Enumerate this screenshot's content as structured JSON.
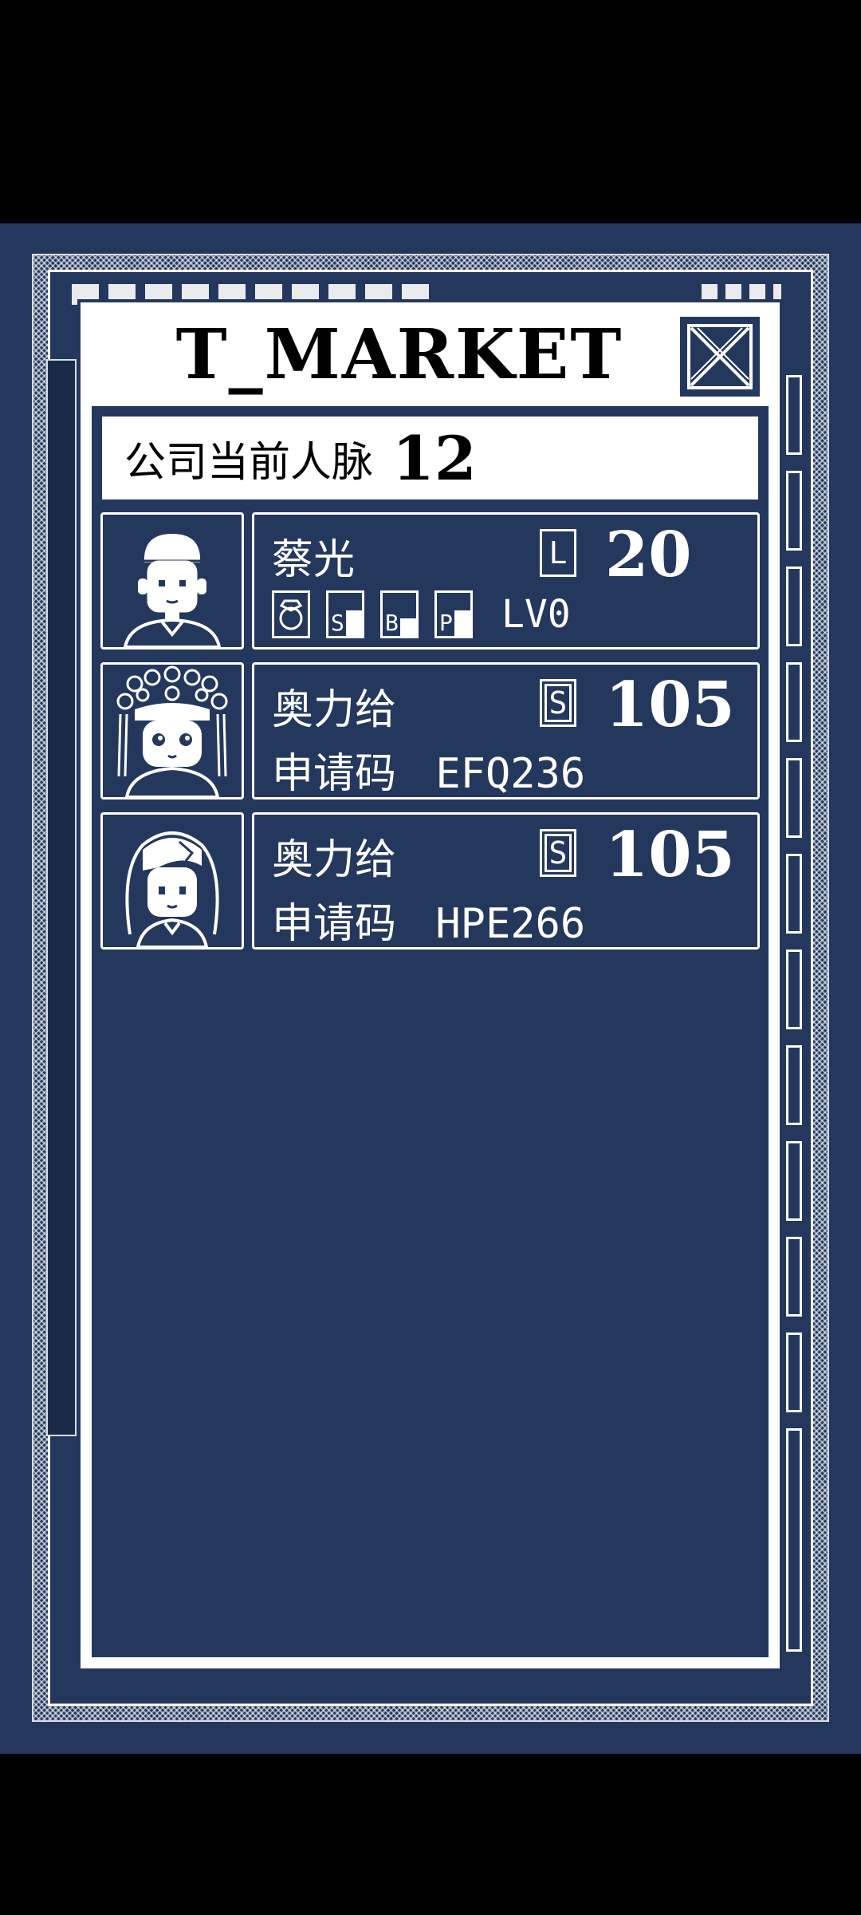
{
  "window": {
    "title": "T_MARKET"
  },
  "contacts": {
    "label": "公司当前人脉",
    "value": "12"
  },
  "people": [
    {
      "name": "蔡光",
      "rank_letter": "L",
      "score": "20",
      "stats": [
        {
          "icon": "diamond-ring-icon",
          "label": ""
        },
        {
          "icon": "stat-s-icon",
          "label": "S",
          "level": 0.6
        },
        {
          "icon": "stat-b-icon",
          "label": "B",
          "level": 0.4
        },
        {
          "icon": "stat-p-icon",
          "label": "P",
          "level": 0.6
        }
      ],
      "level_text": "LV0"
    },
    {
      "name": "奥力给",
      "rank_letter": "S",
      "score": "105",
      "code_label": "申请码",
      "code": "EFQ236"
    },
    {
      "name": "奥力给",
      "rank_letter": "S",
      "score": "105",
      "code_label": "申请码",
      "code": "HPE266"
    }
  ],
  "colors": {
    "background": "#24385e",
    "panel": "#ffffff",
    "outer": "#000000"
  }
}
